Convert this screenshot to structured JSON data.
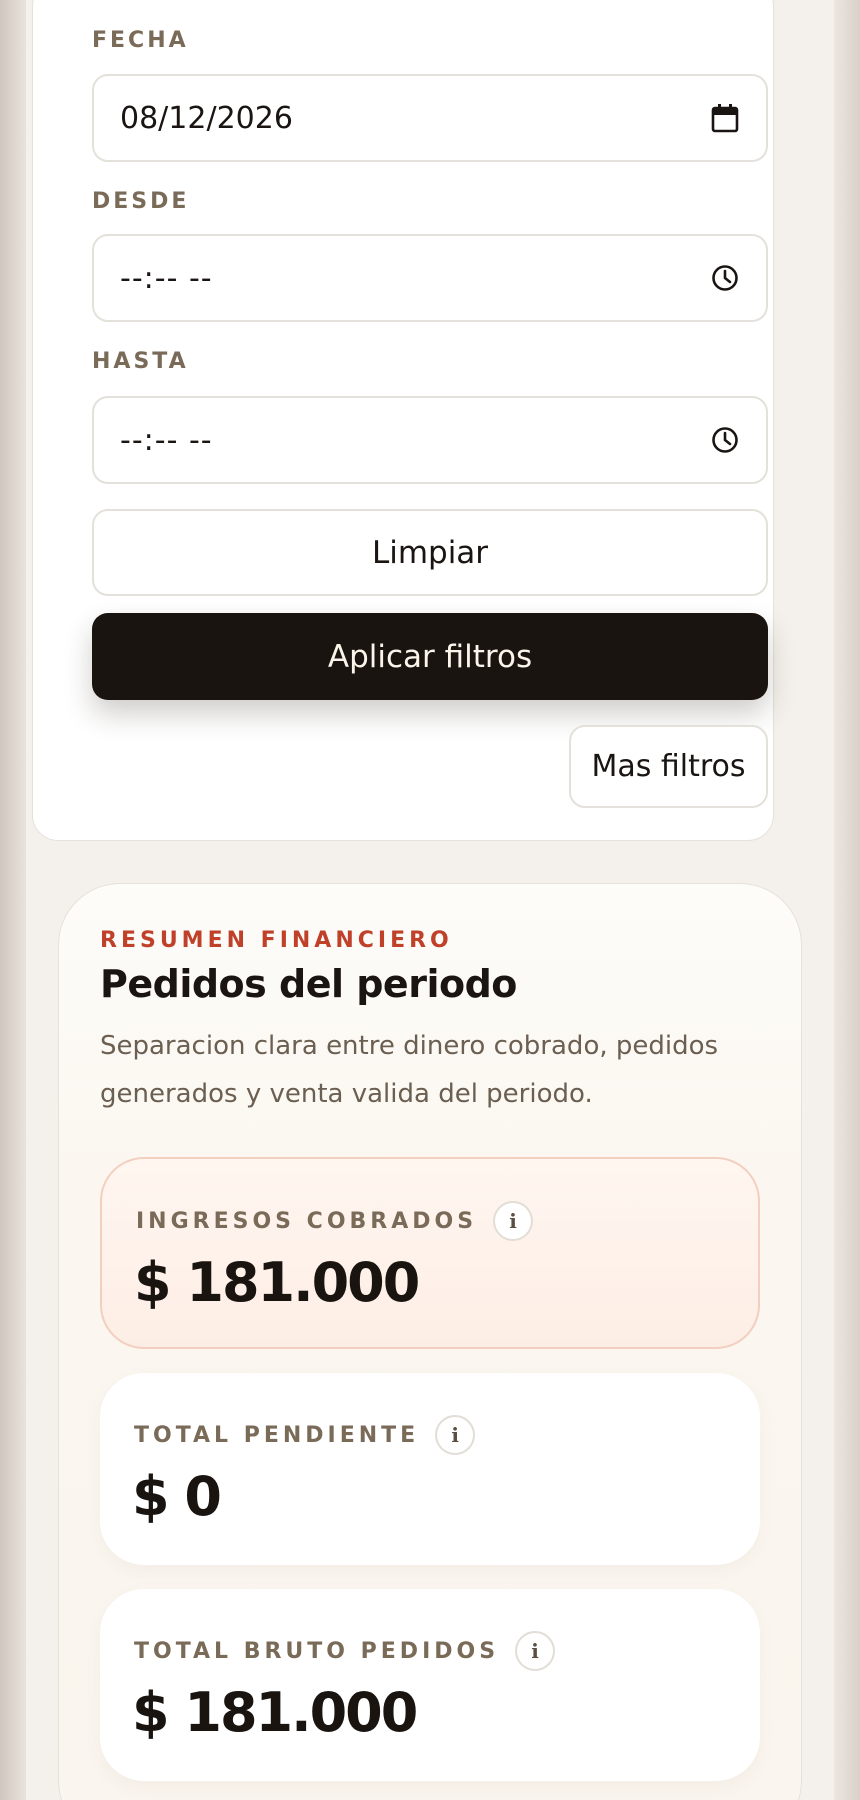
{
  "filters": {
    "date": {
      "label": "FECHA",
      "value": "08/12/2026"
    },
    "from": {
      "label": "DESDE",
      "placeholder": "--:-- --"
    },
    "to": {
      "label": "HASTA",
      "placeholder": "--:-- --"
    },
    "clear_label": "Limpiar",
    "apply_label": "Aplicar filtros",
    "more_label": "Mas filtros"
  },
  "summary": {
    "eyebrow": "RESUMEN FINANCIERO",
    "title": "Pedidos del periodo",
    "description": "Separacion clara entre dinero cobrado, pedidos generados y venta valida del periodo.",
    "metrics": [
      {
        "label": "INGRESOS COBRADOS",
        "value": "$ 181.000",
        "info": "i"
      },
      {
        "label": "TOTAL PENDIENTE",
        "value": "$ 0",
        "info": "i"
      },
      {
        "label": "TOTAL BRUTO PEDIDOS",
        "value": "$ 181.000",
        "info": "i"
      }
    ]
  },
  "icons": {
    "date": "calendar-icon",
    "time": "clock-icon",
    "info": "info-icon"
  },
  "colors": {
    "accent": "#c0412a",
    "primary_button": "#1a1410",
    "highlight_border": "#f2cfbf"
  }
}
